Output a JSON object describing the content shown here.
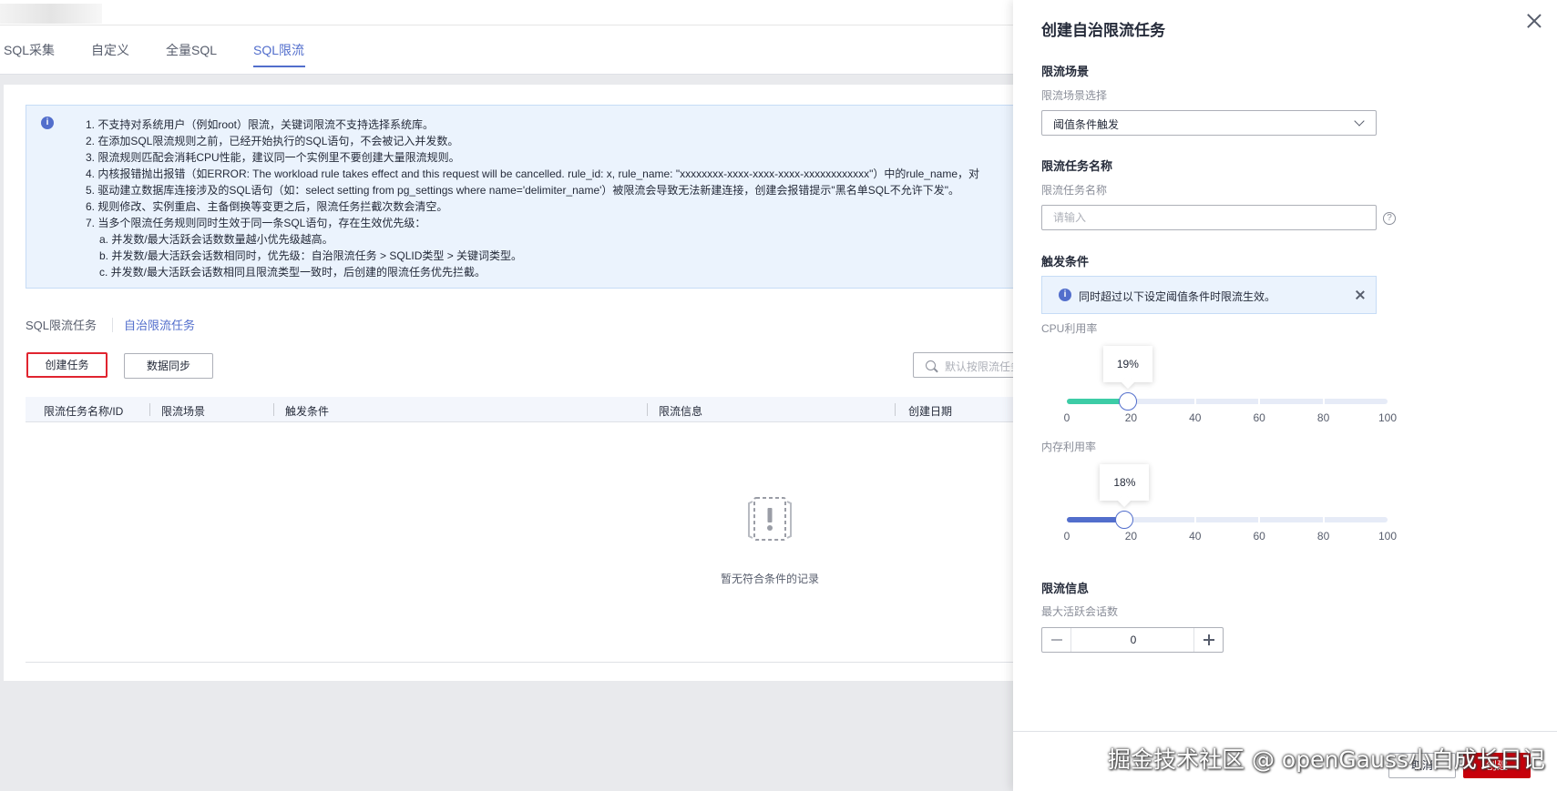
{
  "colors": {
    "accent": "#526ecc",
    "danger": "#c7000b",
    "slider_cpu": "#3dcca6",
    "slider_mem": "#526ecc",
    "notice_bg": "#ebf3fd"
  },
  "header": {
    "tabs": [
      {
        "label": "SQL采集",
        "active": false
      },
      {
        "label": "自定义",
        "active": false
      },
      {
        "label": "全量SQL",
        "active": false
      },
      {
        "label": "SQL限流",
        "active": true
      }
    ]
  },
  "notice": {
    "icon": "info-icon",
    "items": [
      "1. 不支持对系统用户（例如root）限流，关键词限流不支持选择系统库。",
      "2. 在添加SQL限流规则之前，已经开始执行的SQL语句，不会被记入并发数。",
      "3. 限流规则匹配会消耗CPU性能，建议同一个实例里不要创建大量限流规则。",
      "4. 内核报错抛出报错（如ERROR: The workload rule takes effect and this request will be cancelled. rule_id: x, rule_name: \"xxxxxxxx-xxxx-xxxx-xxxx-xxxxxxxxxxxx\"）中的rule_name，对",
      "5. 驱动建立数据库连接涉及的SQL语句（如：select setting from pg_settings where name='delimiter_name'）被限流会导致无法新建连接，创建会报错提示\"黑名单SQL不允许下发\"。",
      "6. 规则修改、实例重启、主备倒换等变更之后，限流任务拦截次数会清空。",
      "7. 当多个限流任务规则同时生效于同一条SQL语句，存在生效优先级："
    ],
    "sub_items": [
      "a. 并发数/最大活跃会话数数量越小优先级越高。",
      "b. 并发数/最大活跃会话数相同时，优先级：自治限流任务 > SQLID类型 > 关键词类型。",
      "c. 并发数/最大活跃会话数相同且限流类型一致时，后创建的限流任务优先拦截。"
    ]
  },
  "subtabs": [
    {
      "label": "SQL限流任务",
      "active": false
    },
    {
      "label": "自治限流任务",
      "active": true
    }
  ],
  "toolbar": {
    "create_label": "创建任务",
    "sync_label": "数据同步",
    "search_placeholder": "默认按限流任务"
  },
  "table": {
    "columns": [
      "限流任务名称/ID",
      "限流场景",
      "触发条件",
      "限流信息",
      "创建日期"
    ],
    "empty_text": "暂无符合条件的记录"
  },
  "drawer": {
    "title": "创建自治限流任务",
    "scene": {
      "section": "限流场景",
      "label": "限流场景选择",
      "value": "阈值条件触发"
    },
    "task_name": {
      "section": "限流任务名称",
      "label": "限流任务名称",
      "placeholder": "请输入"
    },
    "trigger": {
      "section": "触发条件",
      "info": "同时超过以下设定阈值条件时限流生效。",
      "sliders": [
        {
          "label": "CPU利用率",
          "value": 19,
          "display": "19%",
          "min": 0,
          "max": 100,
          "ticks": [
            "0",
            "20",
            "40",
            "60",
            "80",
            "100"
          ]
        },
        {
          "label": "内存利用率",
          "value": 18,
          "display": "18%",
          "min": 0,
          "max": 100,
          "ticks": [
            "0",
            "20",
            "40",
            "60",
            "80",
            "100"
          ]
        }
      ]
    },
    "limit": {
      "section": "限流信息",
      "label": "最大活跃会话数",
      "value": "0"
    },
    "footer": {
      "cancel_label": "取消",
      "submit_label": "创建"
    }
  },
  "watermark": "掘金技术社区 @ openGauss小白成长日记"
}
